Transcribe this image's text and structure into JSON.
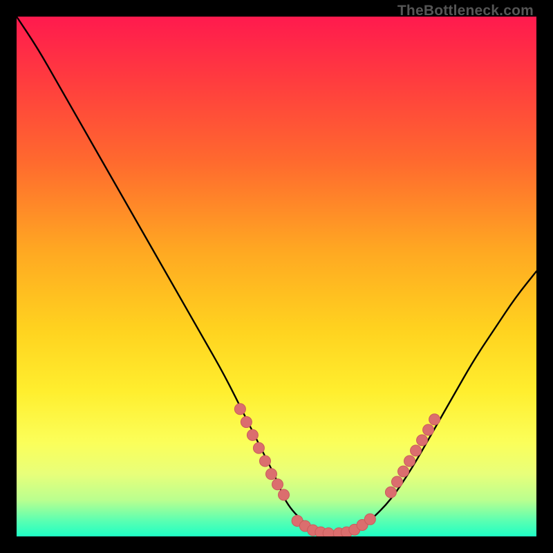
{
  "watermark": "TheBottleneck.com",
  "colors": {
    "frame": "#000000",
    "curve": "#000000",
    "marker_fill": "#db6e6e",
    "marker_stroke": "#c95b5b"
  },
  "chart_data": {
    "type": "line",
    "title": "",
    "xlabel": "",
    "ylabel": "",
    "xlim": [
      0,
      100
    ],
    "ylim": [
      0,
      100
    ],
    "grid": false,
    "legend": false,
    "series": [
      {
        "name": "curve",
        "x": [
          0,
          4,
          8,
          12,
          16,
          20,
          24,
          28,
          32,
          36,
          40,
          44,
          48,
          50,
          52,
          56,
          58,
          60,
          62,
          64,
          66,
          68,
          72,
          76,
          80,
          84,
          88,
          92,
          96,
          100
        ],
        "y": [
          100,
          94,
          87,
          80,
          73,
          66,
          59,
          52,
          45,
          38,
          31,
          23,
          15,
          11,
          6,
          2,
          1,
          0.5,
          0.5,
          0.8,
          1.5,
          3,
          7,
          13,
          20,
          27,
          34,
          40,
          46,
          51
        ]
      }
    ],
    "markers": [
      {
        "group": "left-descent",
        "x": 43.0,
        "y": 24.5
      },
      {
        "group": "left-descent",
        "x": 44.2,
        "y": 22.0
      },
      {
        "group": "left-descent",
        "x": 45.4,
        "y": 19.5
      },
      {
        "group": "left-descent",
        "x": 46.6,
        "y": 17.0
      },
      {
        "group": "left-descent",
        "x": 47.8,
        "y": 14.5
      },
      {
        "group": "left-descent",
        "x": 49.0,
        "y": 12.0
      },
      {
        "group": "left-descent",
        "x": 50.2,
        "y": 10.0
      },
      {
        "group": "left-descent",
        "x": 51.4,
        "y": 8.0
      },
      {
        "group": "valley",
        "x": 54.0,
        "y": 3.0
      },
      {
        "group": "valley",
        "x": 55.5,
        "y": 2.0
      },
      {
        "group": "valley",
        "x": 57.0,
        "y": 1.2
      },
      {
        "group": "valley",
        "x": 58.5,
        "y": 0.8
      },
      {
        "group": "valley",
        "x": 60.0,
        "y": 0.6
      },
      {
        "group": "valley",
        "x": 62.0,
        "y": 0.6
      },
      {
        "group": "valley",
        "x": 63.5,
        "y": 0.8
      },
      {
        "group": "valley",
        "x": 65.0,
        "y": 1.3
      },
      {
        "group": "valley",
        "x": 66.5,
        "y": 2.2
      },
      {
        "group": "valley",
        "x": 68.0,
        "y": 3.3
      },
      {
        "group": "right-ascent",
        "x": 72.0,
        "y": 8.5
      },
      {
        "group": "right-ascent",
        "x": 73.2,
        "y": 10.5
      },
      {
        "group": "right-ascent",
        "x": 74.4,
        "y": 12.5
      },
      {
        "group": "right-ascent",
        "x": 75.6,
        "y": 14.5
      },
      {
        "group": "right-ascent",
        "x": 76.8,
        "y": 16.5
      },
      {
        "group": "right-ascent",
        "x": 78.0,
        "y": 18.5
      },
      {
        "group": "right-ascent",
        "x": 79.2,
        "y": 20.5
      },
      {
        "group": "right-ascent",
        "x": 80.4,
        "y": 22.5
      }
    ]
  }
}
